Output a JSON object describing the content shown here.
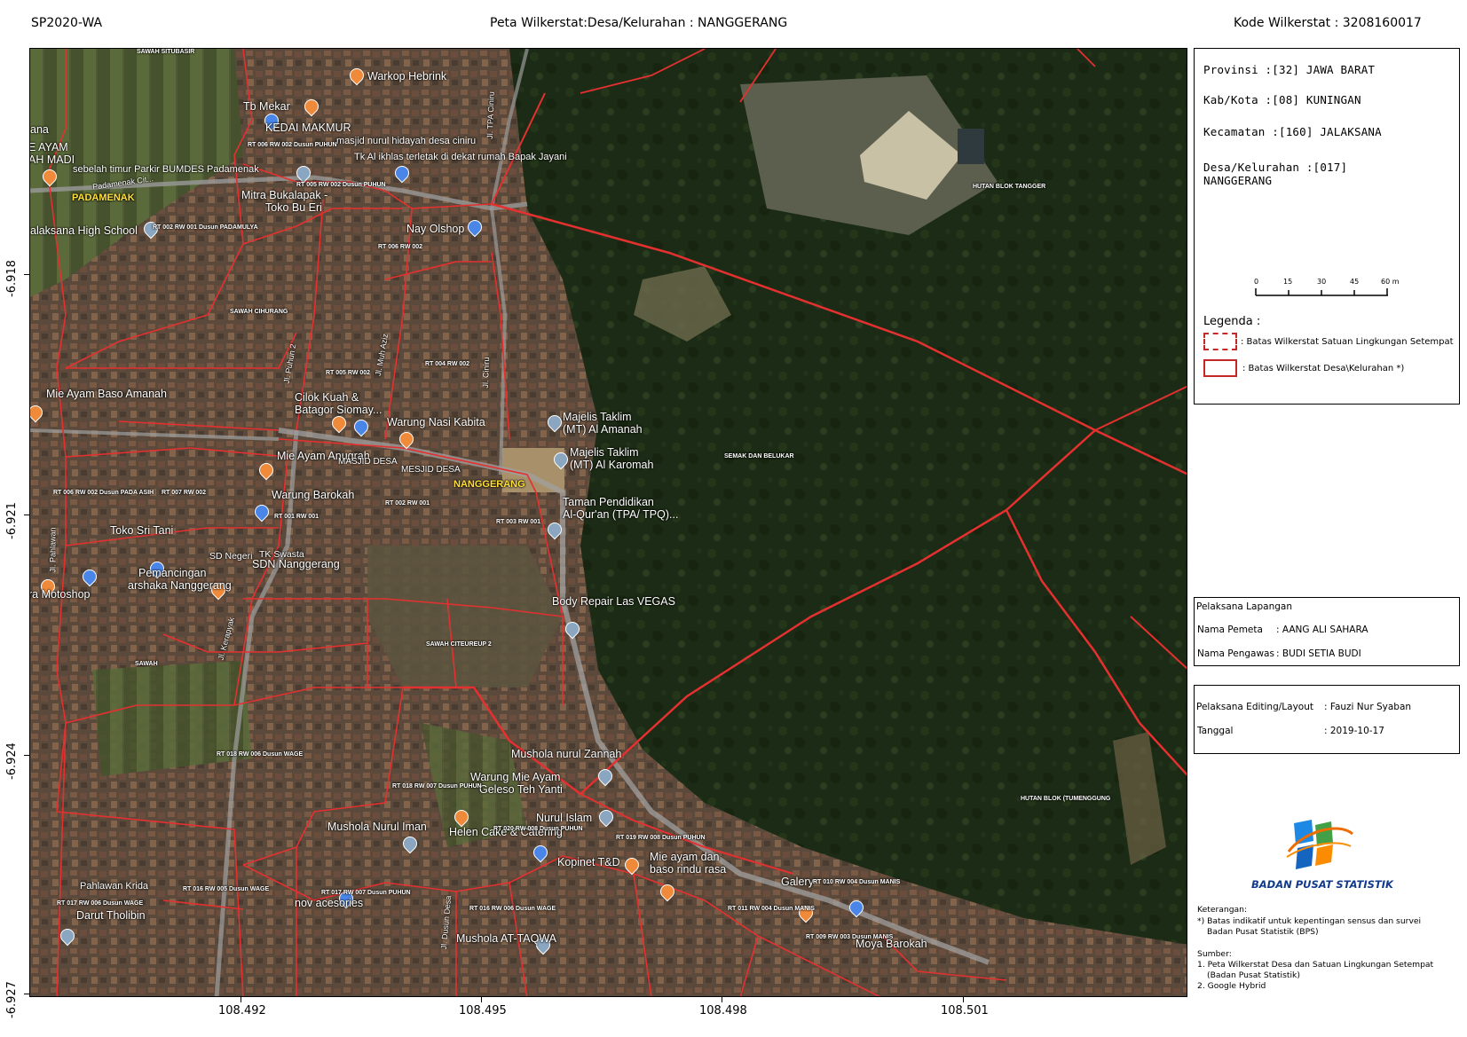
{
  "header": {
    "left": "SP2020-WA",
    "center": "Peta Wilkerstat:Desa/Kelurahan : NANGGERANG",
    "right": "Kode Wilkerstat : 3208160017"
  },
  "axes": {
    "latitudes": [
      "-6.918",
      "-6.921",
      "-6.924",
      "-6.927"
    ],
    "longitudes": [
      "108.492",
      "108.495",
      "108.498",
      "108.501"
    ]
  },
  "info": {
    "provinsi": "Provinsi :[32] JAWA BARAT",
    "kabkota": "Kab/Kota :[08] KUNINGAN",
    "kecamatan": "Kecamatan :[160] JALAKSANA",
    "desa_line1": "Desa/Kelurahan :[017]",
    "desa_line2": "NANGGERANG"
  },
  "scale_bar": {
    "labels": [
      "0",
      "15",
      "30",
      "45",
      "60 m"
    ]
  },
  "legend": {
    "title": "Legenda :",
    "items": [
      {
        "label": ": Batas Wilkerstat Satuan Lingkungan Setempat",
        "style": "dashed",
        "color": "#e53030"
      },
      {
        "label": ": Batas Wilkerstat Desa\\Kelurahan *)",
        "style": "solid",
        "color": "#e53030"
      }
    ]
  },
  "pelaksana_lapangan": {
    "title": "Pelaksana Lapangan",
    "pemeta_label": "Nama Pemeta",
    "pemeta_value": ": AANG ALI SAHARA",
    "pengawas_label": "Nama Pengawas",
    "pengawas_value": ": BUDI SETIA BUDI"
  },
  "pelaksana_editing": {
    "label": "Pelaksana Editing/Layout",
    "value": ": Fauzi Nur Syaban",
    "tanggal_label": "Tanggal",
    "tanggal_value": ": 2019-10-17"
  },
  "logo": {
    "text": "BADAN PUSAT STATISTIK"
  },
  "notes": {
    "keterangan_title": "Keterangan:",
    "keterangan_1": "*) Batas indikatif untuk kepentingan sensus dan survei",
    "keterangan_2": "Badan Pusat Statistik (BPS)",
    "sumber_title": "Sumber:",
    "sumber_1": "1. Peta Wilkerstat Desa dan Satuan Lingkungan Setempat",
    "sumber_1b": "(Badan Pusat Statistik)",
    "sumber_2": "2. Google Hybrid"
  },
  "colors": {
    "boundary": "#e53030",
    "forest": "#1b2a14",
    "village": "#5a4d3e"
  },
  "map_labels": {
    "sawah_situbasir": "SAWAH SITUBASIR",
    "warkop": "Warkop Hebrink",
    "tb_mekar": "Tb Mekar",
    "kedai": "KEDAI MAKMUR",
    "ayam": "E AYAM",
    "ah_madi": "AH MADI",
    "ana": "ana",
    "masjid_nurul": "masjid nurul hidayah desa ciniru",
    "tk_al_ikhlas": "Tk Al ikhlas terletak di dekat rumah Bapak Jayani",
    "sebelah": "sebelah timur Parkir BUMDES Padamenak",
    "padamenak": "PADAMENAK",
    "mitra": "Mitra Bukalapak -",
    "toko_bu": "Toko Bu Eri",
    "high_school": "alaksana High School",
    "nay": "Nay Olshop",
    "sawah_cihurang": "SAWAH CIHURANG",
    "mie_ayam_baso": "Mie Ayam Baso Amanah",
    "cilok": "Cilok Kuah &",
    "batagor": "Batagor Siomay...",
    "warung_nasi": "Warung Nasi Kabita",
    "majelis1a": "Majelis Taklim",
    "majelis1b": "(MT) Al Amanah",
    "majelis2a": "Majelis Taklim",
    "majelis2b": "(MT) Al Karomah",
    "semak": "SEMAK DAN BELUKAR",
    "hutan_tangger": "HUTAN BLOK TANGGER",
    "mie_ayam_anugrah": "Mie Ayam Anugrah",
    "masjid_desa": "MASJID DESA",
    "mesjid_desa": "MESJID DESA",
    "nanggerang": "NANGGERANG",
    "warung_barokah": "Warung Barokah",
    "taman1": "Taman Pendidikan",
    "taman2": "Al-Qur'an (TPA/ TPQ)...",
    "toko_sri": "Toko Sri Tani",
    "sd_negeri": "SD Negeri",
    "tk_swasta": "TK Swasta",
    "sdn": "SDN Nanggerang",
    "pemancingan1": "Pemancingan",
    "pemancingan2": "arshaka Nanggerang",
    "motoshop": "ra Motoshop",
    "body_repair": "Body Repair Las VEGAS",
    "sawah_citeureup": "SAWAH CITEUREUP 2",
    "sawah": "SAWAH",
    "mushola_zannah": "Mushola nurul Zannah",
    "warung_mie1": "Warung Mie Ayam",
    "warung_mie2": "Geleso Teh Yanti",
    "hutan_tumenggung": "HUTAN BLOK (TUMENGGUNG",
    "mushola_iman": "Mushola Nurul Iman",
    "nurul_islam": "Nurul Islam",
    "helen": "Helen Cake & Catering",
    "kopinet": "Kopinet T&D",
    "mie_baso1": "Mie ayam dan",
    "mie_baso2": "baso rindu rasa",
    "pahlawan": "Pahlawan Krida",
    "darut": "Darut Tholibin",
    "nov": "nov acesories",
    "galery": "Galery",
    "at_taqwa": "Mushola AT-TAQWA",
    "moya": "Moya Barokah",
    "jl_ciniru": "Jl. Ciniru",
    "jl_tpa": "Jl. TPA Ciniru",
    "jl_puhun2": "Jl. Puhun 2",
    "jl_muh_aziz": "Jl. Muh Aziz",
    "jl_kerapyak": "Jl. Kerapyak",
    "jl_dusun_desa": "Jl. Dusun Desa",
    "jl_padamenak": "Padamenak Cit...",
    "jl_pahlawan": "Jl. Pahlawan",
    "rt_006_002_puhun": "RT 006 RW 002 Dusun PUHUN",
    "rt_005_002_puhun": "RT 005 RW 002 Dusun PUHUN",
    "rt_002_001_padamulya": "RT 002 RW 001 Dusun PADAMULYA",
    "rt_006_002": "RT 006 RW 002",
    "rt_005_002": "RT 005 RW 002",
    "rt_004_002": "RT 004 RW 002",
    "rt_006_002_padaasih": "RT 006 RW 002 Dusun PADA ASIH",
    "rt_007_002": "RT 007 RW 002",
    "rt_001_001": "RT 001 RW 001",
    "rt_002_001": "RT 002 RW 001",
    "rt_003_001": "RT 003 RW 001",
    "rt_018_006_wage": "RT 018 RW 006 Dusun WAGE",
    "rt_018_007_puhun": "RT 018 RW 007 Dusun PUHUN",
    "rt_020_008_puhun": "RT 020 RW 008 Dusun PUHUN",
    "rt_019_008_puhun": "RT 019 RW 008 Dusun PUHUN",
    "rt_016_005_wage": "RT 016 RW 005 Dusun WAGE",
    "rt_017_007_puhun": "RT 017 RW 007 Dusun PUHUN",
    "rt_017_006_wage": "RT 017 RW 006 Dusun WAGE",
    "rt_016_006_wage": "RT 016 RW 006 Dusun WAGE",
    "rt_011_004_manis": "RT 011 RW 004 Dusun MANIS",
    "rt_010_004_manis": "RT 010 RW 004 Dusun MANIS",
    "rt_009_003_manis": "RT 009 RW 003 Dusun MANIS"
  }
}
